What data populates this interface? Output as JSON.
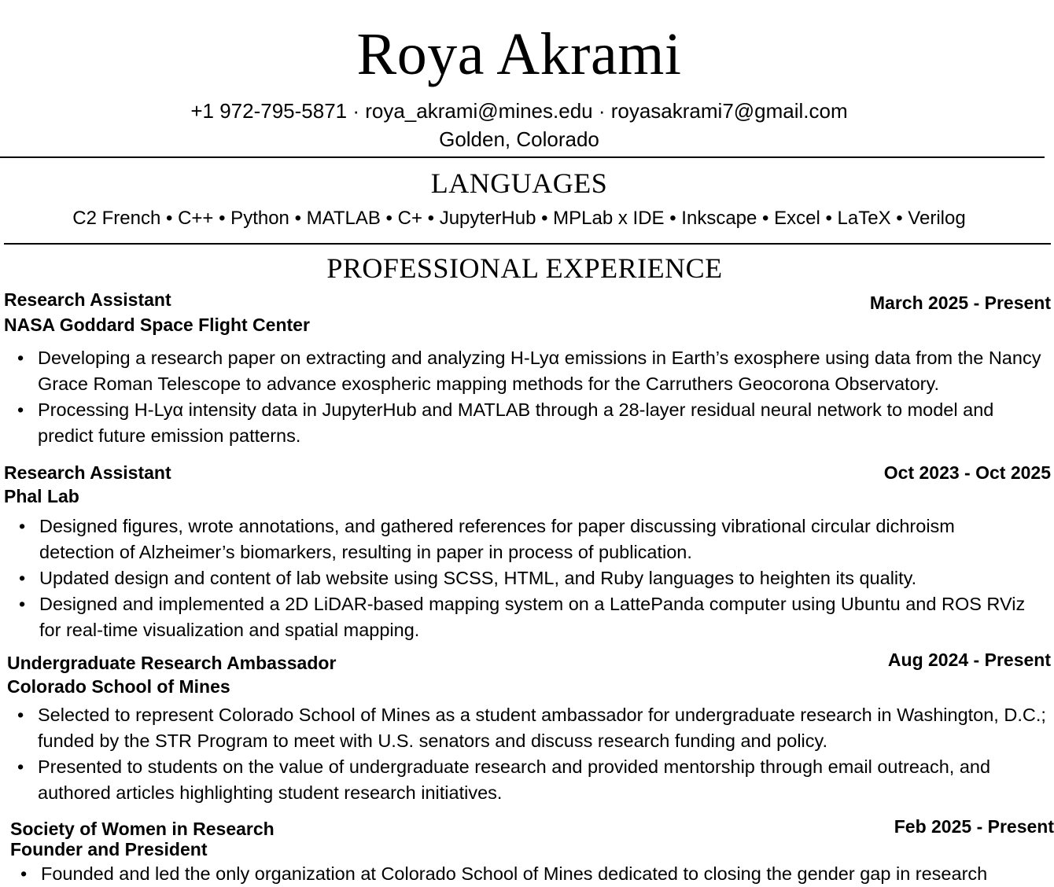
{
  "header": {
    "name": "Roya Akrami",
    "contact": "+1 972-795-5871 · roya_akrami@mines.edu · royasakrami7@gmail.com",
    "location": "Golden, Colorado"
  },
  "languages": {
    "title": "LANGUAGES",
    "items": "C2 French • C++ • Python • MATLAB • C+ • JupyterHub • MPLab x IDE • Inkscape • Excel • LaTeX • Verilog"
  },
  "experience": {
    "title": "PROFESSIONAL EXPERIENCE",
    "bullet_char": "•",
    "jobs": [
      {
        "role": "Research Assistant",
        "org": "NASA Goddard Space Flight Center",
        "date": "March 2025 - Present",
        "bullets": [
          "Developing a research paper on extracting and analyzing H-Lyα emissions in Earth’s exosphere using data from the Nancy Grace Roman Telescope to advance exospheric mapping methods for the Carruthers Geocorona Observatory.",
          "Processing H-Lyα intensity data in JupyterHub and MATLAB through a 28-layer residual neural network to model and predict future emission patterns."
        ]
      },
      {
        "role": "Research Assistant",
        "org": "Phal Lab",
        "date": "Oct 2023 - Oct 2025",
        "bullets": [
          "Designed figures, wrote annotations, and gathered references for paper discussing vibrational circular dichroism detection of Alzheimer’s biomarkers, resulting in paper in process of publication.",
          "Updated design and content of lab website using SCSS, HTML, and Ruby languages to heighten its quality.",
          "Designed and implemented a 2D LiDAR-based mapping system on a LattePanda computer using Ubuntu and ROS RViz for real-time visualization and spatial mapping."
        ]
      },
      {
        "role": "Undergraduate Research Ambassador",
        "org": "Colorado School of Mines",
        "date": "Aug 2024 - Present",
        "bullets": [
          "Selected to represent Colorado School of Mines as a student ambassador for undergraduate research in Washington, D.C.; funded by the STR Program to meet with U.S. senators and discuss research funding and policy.",
          "Presented to students on the value of undergraduate research and provided mentorship through email outreach, and authored articles highlighting student research initiatives."
        ]
      },
      {
        "role": "Society of Women in Research",
        "org": "Founder and President",
        "date": "Feb 2025 - Present",
        "bullets": [
          "Founded and led the only organization at Colorado School of Mines dedicated to closing the gender gap in research"
        ]
      }
    ]
  }
}
